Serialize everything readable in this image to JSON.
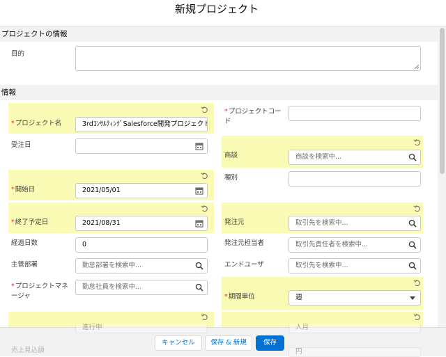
{
  "modal": {
    "title": "新規プロジェクト"
  },
  "sections": {
    "project_info": {
      "title": "プロジェクトの情報",
      "purpose_label": "目的",
      "purpose_value": ""
    },
    "info": {
      "title": "情報"
    }
  },
  "fields": {
    "project_name": {
      "required": "*",
      "label": "プロジェクト名",
      "value": "3rdｺﾝｻﾙﾃｨﾝｸﾞSalesforce開発プロジェクト"
    },
    "project_code": {
      "required": "*",
      "label": "プロジェクトコード",
      "value": ""
    },
    "order_date": {
      "label": "受注日",
      "value": ""
    },
    "opportunity": {
      "label": "商談",
      "placeholder": "商談を検索中..."
    },
    "start_date": {
      "required": "*",
      "label": "開始日",
      "value": "2021/05/01"
    },
    "type": {
      "label": "種別",
      "value": ""
    },
    "end_date": {
      "required": "*",
      "label": "終了予定日",
      "value": "2021/08/31"
    },
    "orderer": {
      "label": "発注元",
      "placeholder": "取引先を検索中..."
    },
    "elapsed_days": {
      "label": "経過日数",
      "value": "0"
    },
    "orderer_contact": {
      "label": "発注元担当者",
      "placeholder": "取引先責任者を検索中..."
    },
    "department": {
      "label": "主管部署",
      "placeholder": "勤怠部署を検索中..."
    },
    "end_user": {
      "label": "エンドユーザ",
      "placeholder": "取引先を検索中..."
    },
    "project_manager": {
      "required": "*",
      "label": "プロジェクトマネージャ",
      "placeholder": "勤怠社員を検索中..."
    },
    "period_unit": {
      "required": "*",
      "label": "期間単位",
      "value": "週"
    },
    "status": {
      "value": "進行中"
    },
    "work_unit": {
      "value": "人月"
    },
    "currency": {
      "value": "円"
    },
    "partial_label": "売上見込額"
  },
  "footer": {
    "cancel_label": "キャンセル",
    "save_new_label": "保存 & 新規",
    "save_label": "保存"
  },
  "colors": {
    "accent": "#0070d2",
    "highlight": "#fafbb4",
    "required": "#c23934"
  }
}
